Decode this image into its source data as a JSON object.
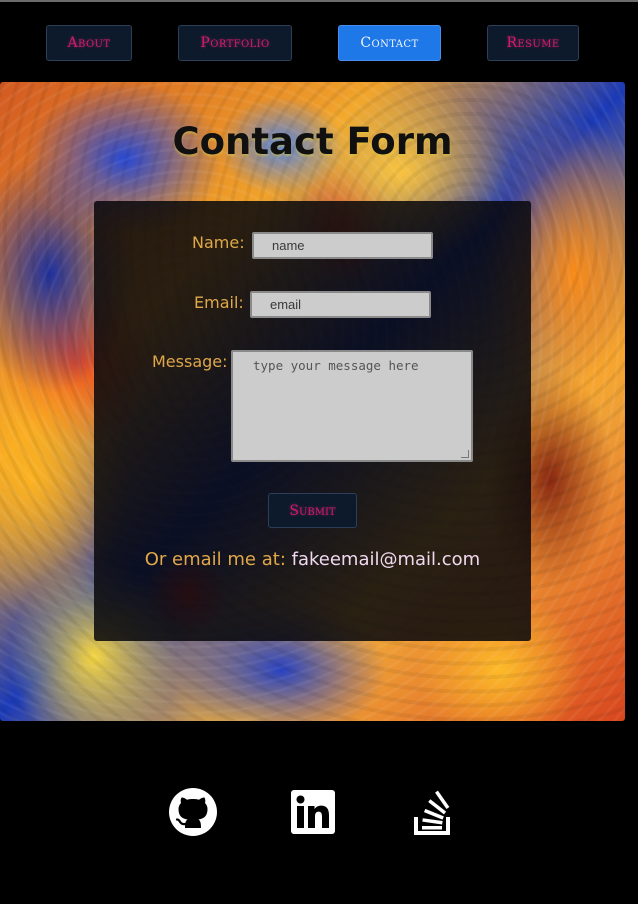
{
  "nav": {
    "items": [
      {
        "label": "About",
        "active": false
      },
      {
        "label": "Portfolio",
        "active": false
      },
      {
        "label": "Contact",
        "active": true
      },
      {
        "label": "Resume",
        "active": false
      }
    ]
  },
  "main": {
    "title": "Contact Form",
    "form": {
      "name_label": "Name:",
      "name_placeholder": "name",
      "email_label": "Email:",
      "email_placeholder": "email",
      "message_label": "Message:",
      "message_placeholder": "type your message here",
      "submit_label": "Submit"
    },
    "email_prefix": "Or email me at:",
    "email_address": "fakeemail@mail.com"
  },
  "footer": {
    "icons": [
      "github-icon",
      "linkedin-icon",
      "stack-overflow-icon"
    ]
  },
  "colors": {
    "nav_text": "#d8186e",
    "active_nav": "#1e78e8",
    "label": "#e0a848",
    "background": "#000000"
  }
}
